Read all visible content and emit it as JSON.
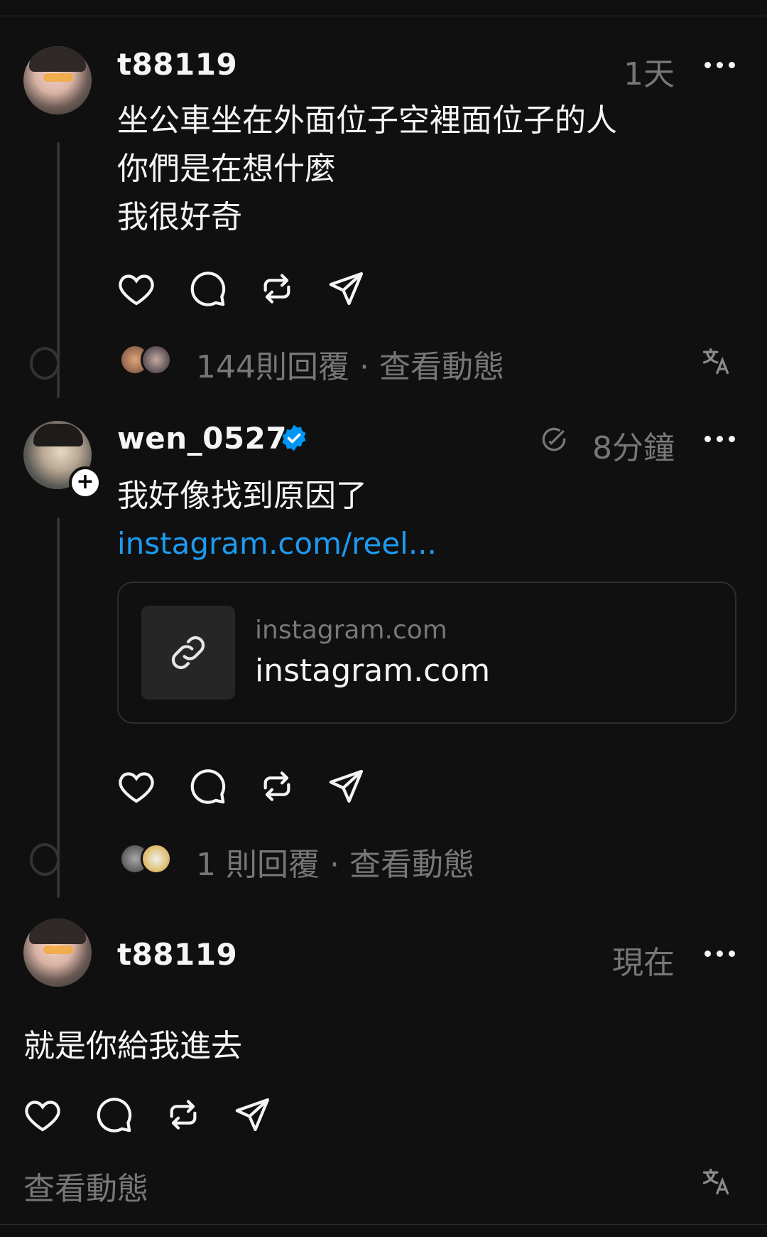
{
  "posts": [
    {
      "username": "t88119",
      "time": "1天",
      "text": "坐公車坐在外面位子空裡面位子的人\n你們是在想什麼\n我很好奇",
      "stats": "144則回覆 · 查看動態"
    },
    {
      "username": "wen_0527",
      "verified": true,
      "time": "8分鐘",
      "text": "我好像找到原因了",
      "link": "instagram.com/reel...",
      "card": {
        "domain": "instagram.com",
        "title": "instagram.com"
      },
      "stats": "1 則回覆 · 查看動態"
    },
    {
      "username": "t88119",
      "time": "現在",
      "text": "就是你給我進去",
      "stats": "查看動態"
    }
  ],
  "colors": {
    "background": "#101010",
    "link": "#1d9bf0",
    "verified": "#0095f6",
    "muted": "#777777"
  },
  "icons": [
    "heart-icon",
    "comment-icon",
    "repost-icon",
    "share-icon",
    "more-icon",
    "translate-icon",
    "link-icon",
    "verified-icon",
    "edit-icon"
  ]
}
